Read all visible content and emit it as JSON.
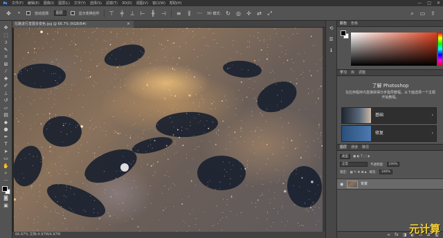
{
  "menubar": {
    "items": [
      "文件(F)",
      "编辑(E)",
      "图像(I)",
      "图层(L)",
      "文字(Y)",
      "选择(S)",
      "滤镜(T)",
      "3D(D)",
      "视图(V)",
      "窗口(W)",
      "帮助(H)"
    ],
    "minimize": "—",
    "maximize": "□",
    "close": "✕"
  },
  "options": {
    "auto_select_label": "自动选择:",
    "auto_select_value": "图层",
    "transform_label": "显示变换控件",
    "mode_3d": "3D 模式:"
  },
  "document": {
    "tab_title": "在路进行发展多变色.jpg @ 66.7% (RGB/8#)",
    "tab_close": "×",
    "status": "66.67%    文档:4.97M/4.97M"
  },
  "color_panel": {
    "tabs": [
      "颜色",
      "色板"
    ]
  },
  "learn_panel": {
    "tabs": [
      "学习",
      "库",
      "调整"
    ],
    "title": "了解 Photoshop",
    "description": "在应用程序内直接获得分步指导教程。从下面选择一个主题开始教程。",
    "cards": [
      {
        "label": "基础",
        "arrow": "›"
      },
      {
        "label": "修复",
        "arrow": "›"
      }
    ]
  },
  "layers_panel": {
    "tabs": [
      "图层",
      "通道",
      "路径"
    ],
    "kind_filter": "类型",
    "blend_mode": "正常",
    "opacity_label": "不透明度:",
    "opacity_value": "100%",
    "lock_label": "锁定:",
    "fill_label": "填充:",
    "fill_value": "100%",
    "layers": [
      {
        "name": "背景",
        "visible": true
      }
    ]
  },
  "watermark": "元计算"
}
